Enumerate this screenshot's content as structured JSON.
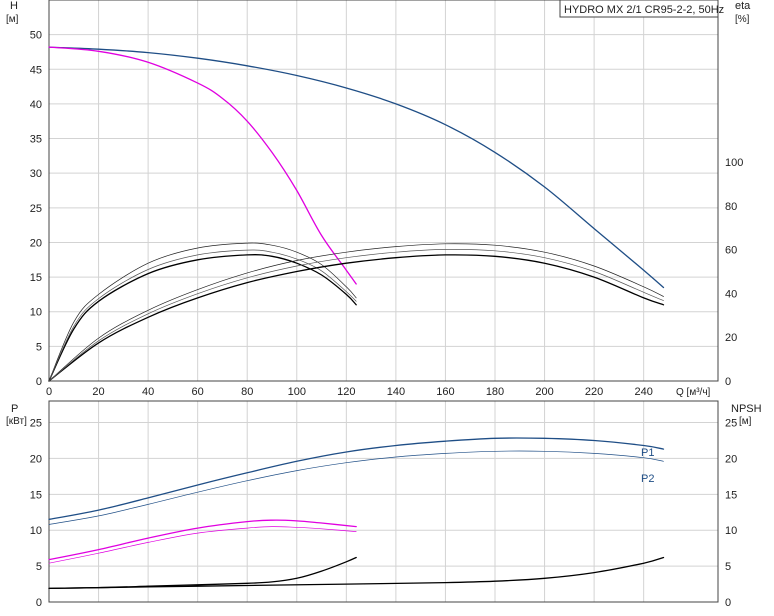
{
  "chart_data": [
    {
      "type": "line",
      "panel": "head-efficiency",
      "title": "HYDRO MX 2/1 CR95-2-2, 50Hz",
      "xlabel": "Q [м³/ч]",
      "ylabel": "H",
      "ylabel_unit": "[м]",
      "y2label": "eta",
      "y2label_unit": "[%]",
      "xlim": [
        0,
        270
      ],
      "ylim": [
        0,
        55
      ],
      "y2lim": [
        0,
        100
      ],
      "xticks": [
        0,
        20,
        40,
        60,
        80,
        100,
        120,
        140,
        160,
        180,
        200,
        220,
        240
      ],
      "yticks": [
        0,
        5,
        10,
        15,
        20,
        25,
        30,
        35,
        40,
        45,
        50
      ],
      "y2ticks": [
        0,
        20,
        40,
        60,
        80,
        100
      ],
      "grid": true,
      "series": [
        {
          "axis": "y",
          "color": "#1f4e86",
          "width": 1.3,
          "x": [
            0,
            20,
            40,
            60,
            80,
            100,
            120,
            140,
            160,
            180,
            200,
            220,
            240,
            248
          ],
          "values": [
            48.2,
            47.9,
            47.4,
            46.6,
            45.5,
            44.1,
            42.3,
            40.0,
            37.0,
            33.0,
            28.0,
            22.0,
            16.0,
            13.5
          ]
        },
        {
          "axis": "y",
          "color": "#e000e0",
          "width": 1.3,
          "x": [
            0,
            20,
            40,
            60,
            70,
            80,
            90,
            100,
            110,
            120,
            124
          ],
          "values": [
            48.2,
            47.6,
            46.0,
            43.0,
            40.8,
            37.5,
            33.0,
            27.5,
            21.0,
            16.0,
            14.0
          ]
        },
        {
          "axis": "y",
          "color": "#000000",
          "width": 1.3,
          "x": [
            0,
            10,
            20,
            40,
            60,
            80,
            90,
            100,
            110,
            120,
            124
          ],
          "values": [
            0,
            7.5,
            11.5,
            15.5,
            17.5,
            18.2,
            18.0,
            17.0,
            15.3,
            12.5,
            11.0
          ]
        },
        {
          "axis": "y",
          "color": "#222222",
          "width": 0.7,
          "x": [
            0,
            10,
            20,
            40,
            60,
            80,
            90,
            100,
            110,
            120,
            124
          ],
          "values": [
            0,
            8.5,
            12.5,
            17.0,
            19.2,
            19.9,
            19.6,
            18.6,
            16.8,
            13.6,
            12.0
          ]
        },
        {
          "axis": "y",
          "color": "#555555",
          "width": 0.7,
          "x": [
            0,
            10,
            20,
            40,
            60,
            80,
            90,
            100,
            110,
            120,
            124
          ],
          "values": [
            0,
            7.9,
            11.9,
            16.1,
            18.2,
            18.9,
            18.6,
            17.6,
            15.9,
            12.9,
            11.5
          ]
        },
        {
          "axis": "y",
          "color": "#000000",
          "width": 1.3,
          "x": [
            0,
            20,
            40,
            60,
            80,
            100,
            120,
            140,
            160,
            180,
            200,
            220,
            240,
            248
          ],
          "values": [
            0,
            5.5,
            9.2,
            12.0,
            14.2,
            15.8,
            17.0,
            17.8,
            18.2,
            18.0,
            17.0,
            15.0,
            12.0,
            11.0
          ]
        },
        {
          "axis": "y",
          "color": "#222222",
          "width": 0.7,
          "x": [
            0,
            20,
            40,
            60,
            80,
            100,
            120,
            140,
            160,
            180,
            200,
            220,
            240,
            248
          ],
          "values": [
            0,
            6.2,
            10.2,
            13.2,
            15.6,
            17.4,
            18.6,
            19.4,
            19.8,
            19.6,
            18.6,
            16.6,
            13.6,
            12.2
          ]
        },
        {
          "axis": "y",
          "color": "#555555",
          "width": 0.7,
          "x": [
            0,
            20,
            40,
            60,
            80,
            100,
            120,
            140,
            160,
            180,
            200,
            220,
            240,
            248
          ],
          "values": [
            0,
            5.8,
            9.7,
            12.6,
            14.9,
            16.6,
            17.8,
            18.6,
            19.0,
            18.8,
            17.8,
            15.8,
            12.8,
            11.6
          ]
        }
      ]
    },
    {
      "type": "line",
      "panel": "power-npsh",
      "xlabel": "",
      "ylabel": "P",
      "ylabel_unit": "[кВт]",
      "y2label": "NPSH",
      "y2label_unit": "[м]",
      "xlim": [
        0,
        270
      ],
      "ylim": [
        0,
        28
      ],
      "y2lim": [
        0,
        28
      ],
      "yticks": [
        0,
        5,
        10,
        15,
        20,
        25
      ],
      "y2ticks": [
        0,
        5,
        10,
        15,
        20,
        25
      ],
      "grid": true,
      "series": [
        {
          "name": "P1",
          "axis": "y",
          "color": "#1f4e86",
          "width": 1.3,
          "x": [
            0,
            20,
            40,
            60,
            80,
            100,
            120,
            140,
            160,
            180,
            200,
            220,
            240,
            248
          ],
          "values": [
            11.5,
            12.8,
            14.5,
            16.3,
            18.0,
            19.6,
            20.9,
            21.8,
            22.4,
            22.8,
            22.8,
            22.5,
            21.8,
            21.3
          ]
        },
        {
          "name": "P2",
          "axis": "y",
          "color": "#1f4e86",
          "width": 0.7,
          "x": [
            0,
            20,
            40,
            60,
            80,
            100,
            120,
            140,
            160,
            180,
            200,
            220,
            240,
            248
          ],
          "values": [
            10.8,
            12.0,
            13.6,
            15.3,
            16.9,
            18.3,
            19.4,
            20.2,
            20.7,
            21.0,
            21.0,
            20.7,
            20.1,
            19.6
          ]
        },
        {
          "axis": "y",
          "color": "#e000e0",
          "width": 1.3,
          "x": [
            0,
            20,
            40,
            60,
            80,
            90,
            100,
            110,
            124
          ],
          "values": [
            5.9,
            7.3,
            8.9,
            10.3,
            11.2,
            11.4,
            11.3,
            11.0,
            10.5
          ]
        },
        {
          "axis": "y",
          "color": "#e000e0",
          "width": 0.7,
          "x": [
            0,
            20,
            40,
            60,
            80,
            90,
            100,
            110,
            124
          ],
          "values": [
            5.4,
            6.8,
            8.3,
            9.6,
            10.3,
            10.5,
            10.4,
            10.2,
            9.8
          ]
        },
        {
          "axis": "y2",
          "color": "#000000",
          "width": 1.3,
          "x": [
            0,
            20,
            40,
            60,
            80,
            90,
            100,
            110,
            120,
            124
          ],
          "values": [
            1.9,
            2.0,
            2.2,
            2.4,
            2.6,
            2.8,
            3.3,
            4.3,
            5.6,
            6.2
          ]
        },
        {
          "axis": "y2",
          "color": "#000000",
          "width": 1.3,
          "x": [
            0,
            40,
            80,
            120,
            160,
            180,
            200,
            220,
            240,
            248
          ],
          "values": [
            1.9,
            2.1,
            2.3,
            2.5,
            2.7,
            2.9,
            3.3,
            4.1,
            5.4,
            6.2
          ]
        }
      ]
    }
  ]
}
